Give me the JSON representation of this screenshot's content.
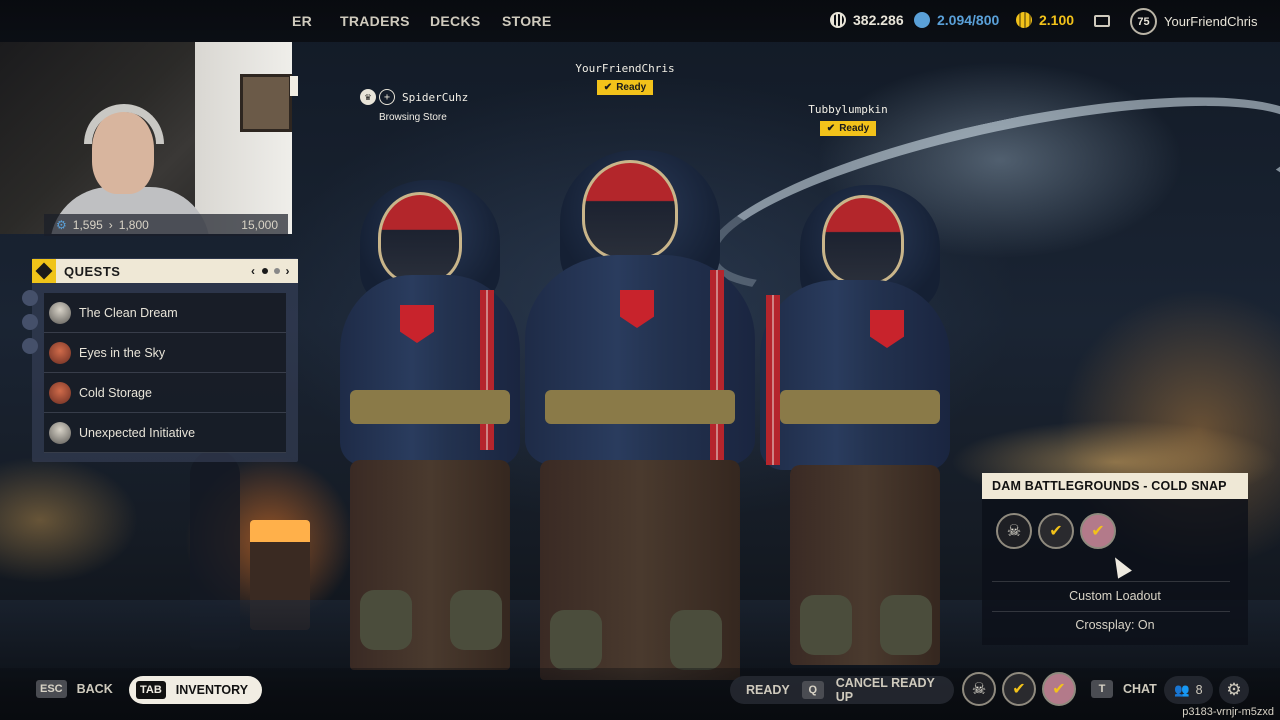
{
  "nav": {
    "items": [
      "ER",
      "TRADERS",
      "DECKS",
      "STORE"
    ]
  },
  "currencies": [
    {
      "icon": "coins-icon",
      "value": "382.286",
      "color": "#e8e4d8"
    },
    {
      "icon": "raider-token-icon",
      "value": "2.094/800",
      "color": "#5aa0d8"
    },
    {
      "icon": "premium-currency-icon",
      "value": "2.100",
      "color": "#f2c21a"
    }
  ],
  "account": {
    "level": "75",
    "username": "YourFriendChris"
  },
  "webcam": {
    "xp_current": "1,595",
    "xp_next": "1,800",
    "xp_max": "15,000"
  },
  "quests": {
    "title": "QUESTS",
    "items": [
      {
        "name": "The Clean Dream"
      },
      {
        "name": "Eyes in the Sky"
      },
      {
        "name": "Cold Storage"
      },
      {
        "name": "Unexpected Initiative"
      }
    ]
  },
  "party": {
    "members": [
      {
        "name": "SpiderCuhz",
        "status": "Browsing Store"
      },
      {
        "name": "YourFriendChris",
        "status": "Ready"
      },
      {
        "name": "Tubbylumpkin",
        "status": "Ready"
      }
    ]
  },
  "mode": {
    "title": "DAM BATTLEGROUNDS - COLD SNAP",
    "loadout": "Custom Loadout",
    "crossplay": "Crossplay: On"
  },
  "bottom": {
    "back_key": "ESC",
    "back_label": "BACK",
    "inventory_key": "TAB",
    "inventory_label": "INVENTORY",
    "ready_label": "READY",
    "cancel_key": "Q",
    "cancel_label": "CANCEL READY UP",
    "chat_key": "T",
    "chat_label": "CHAT",
    "party_count": "8"
  },
  "session_id": "p3183-vrnjr-m5zxd"
}
